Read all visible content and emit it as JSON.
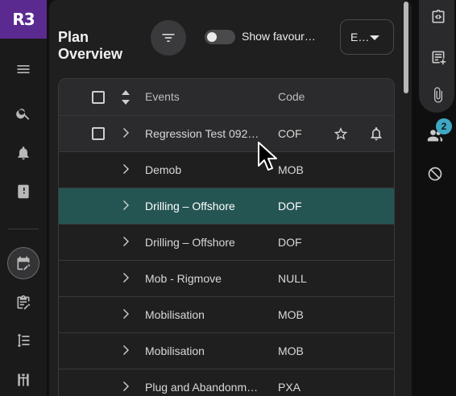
{
  "app": {
    "logo_text": "R3",
    "brand_color": "#5b2a91"
  },
  "left_rail": {
    "items": [
      {
        "icon": "menu-icon"
      },
      {
        "icon": "search-icon"
      },
      {
        "icon": "bell-icon"
      },
      {
        "icon": "book-icon"
      },
      {
        "icon": "calendar-edit-icon",
        "active": true
      },
      {
        "icon": "clipboard-edit-icon"
      },
      {
        "icon": "list-numbered-icon"
      },
      {
        "icon": "rig-icon"
      }
    ]
  },
  "header": {
    "title": "Plan Overview",
    "show_favourites_label": "Show favour…",
    "select_value": "E…"
  },
  "table": {
    "columns": {
      "events": "Events",
      "code": "Code"
    },
    "rows": [
      {
        "event": "Regression Test 092…",
        "code": "COF",
        "state": "hover"
      },
      {
        "event": "Demob",
        "code": "MOB"
      },
      {
        "event": "Drilling – Offshore",
        "code": "DOF",
        "state": "selected"
      },
      {
        "event": "Drilling – Offshore",
        "code": "DOF"
      },
      {
        "event": "Mob - Rigmove",
        "code": "NULL"
      },
      {
        "event": "Mobilisation",
        "code": "MOB"
      },
      {
        "event": "Mobilisation",
        "code": "MOB"
      },
      {
        "event": "Plug and Abandonm…",
        "code": "PXA"
      }
    ],
    "selected_color": "#245553"
  },
  "right_rail": {
    "items": [
      {
        "icon": "code-document-icon"
      },
      {
        "icon": "add-document-icon"
      },
      {
        "icon": "paperclip-icon"
      },
      {
        "icon": "users-icon"
      },
      {
        "icon": "block-icon"
      }
    ],
    "users_badge": "2",
    "badge_color": "#3fa7c4"
  }
}
